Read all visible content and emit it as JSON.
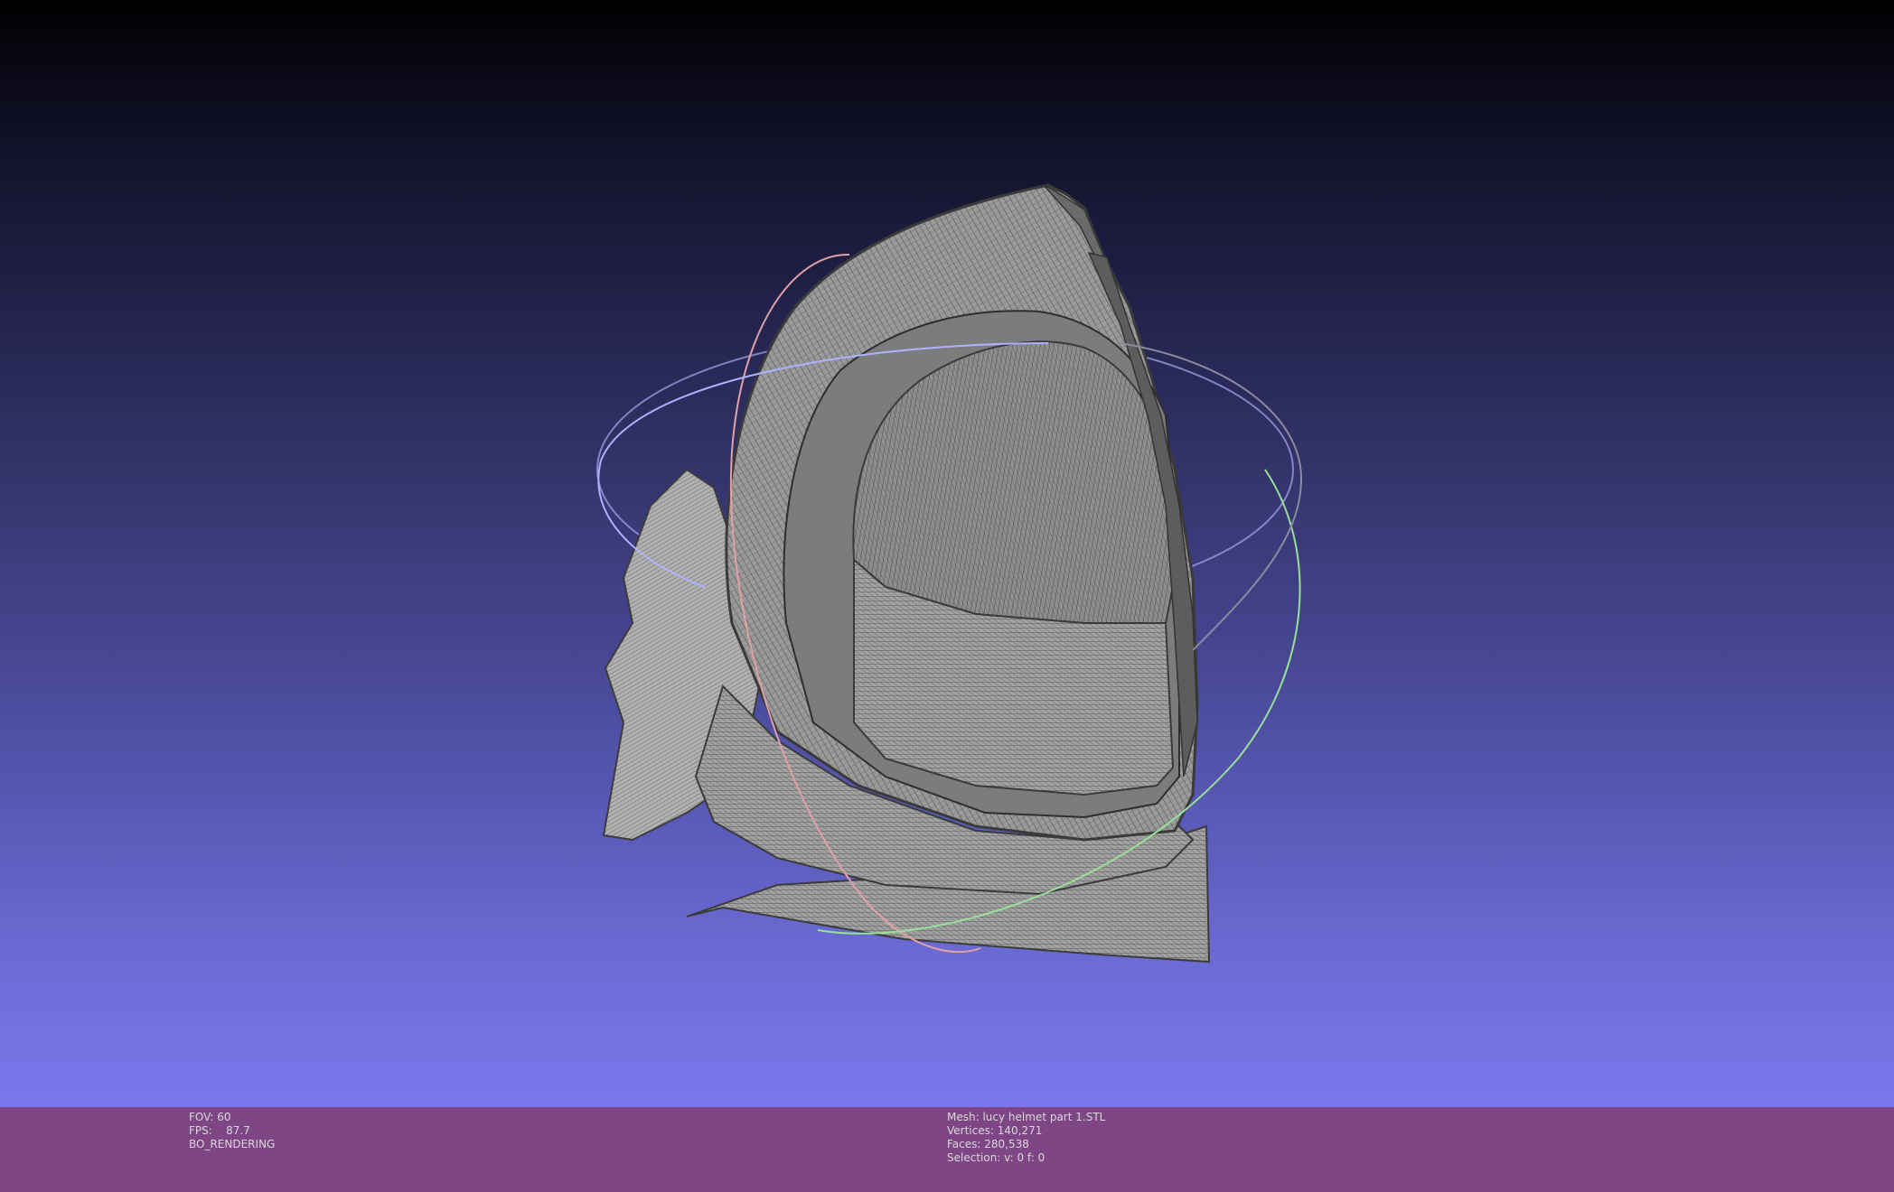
{
  "viewer": {
    "background_top": "#000000",
    "background_bottom": "#7878ec",
    "mesh_color": "#a8a8a8",
    "wire_color": "#3a3a3a",
    "trackball_colors": {
      "x_ring": "#e0a0a8",
      "y_ring": "#98e098",
      "z_ring": "#a8a8f0"
    }
  },
  "info_left": {
    "fov_label": "FOV:",
    "fov_value": "60",
    "fps_label": "FPS:",
    "fps_value": "87.7",
    "render_mode": "BO_RENDERING"
  },
  "info_right": {
    "mesh_label": "Mesh:",
    "mesh_name": "lucy helmet part 1.STL",
    "vertices_label": "Vertices:",
    "vertices_value": "140,271",
    "faces_label": "Faces:",
    "faces_value": "280,538",
    "selection_label": "Selection:",
    "selection_value": "v: 0 f: 0"
  },
  "status_bar_color": "#7f4686"
}
